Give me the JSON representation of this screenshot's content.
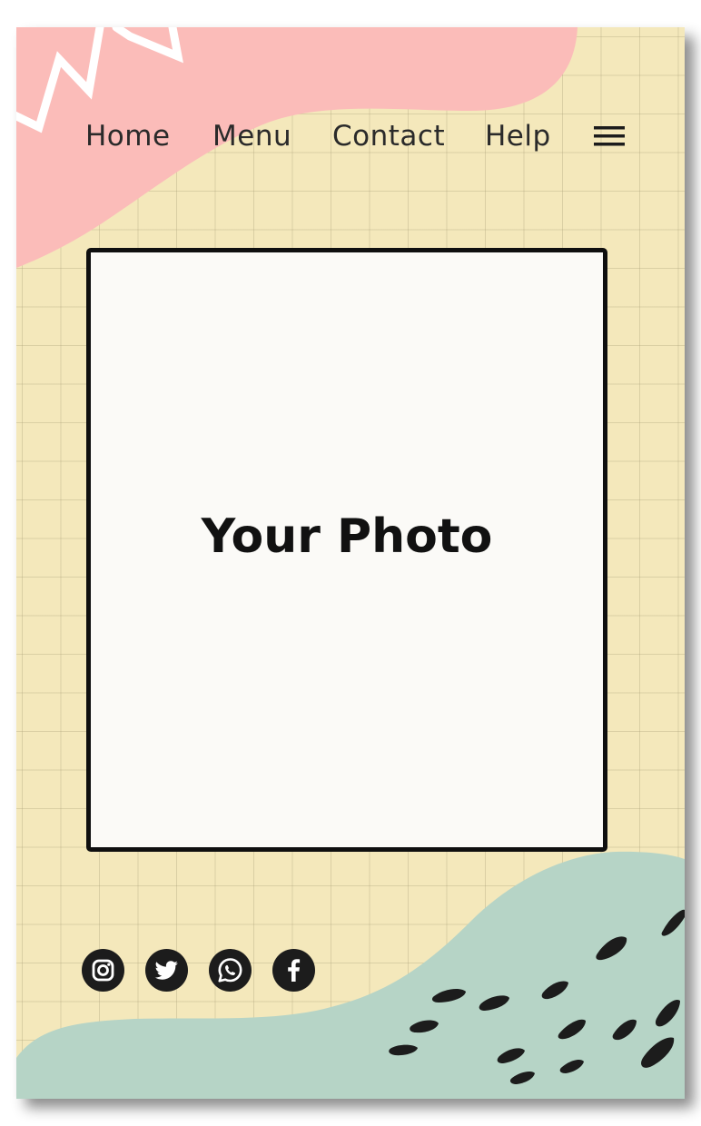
{
  "nav": {
    "items": [
      "Home",
      "Menu",
      "Contact",
      "Help"
    ]
  },
  "menu_icon": "hamburger-menu-icon",
  "photo": {
    "placeholder_text": "Your Photo"
  },
  "social_links": [
    {
      "icon": "instagram-icon"
    },
    {
      "icon": "twitter-icon"
    },
    {
      "icon": "whatsapp-icon"
    },
    {
      "icon": "facebook-icon"
    }
  ],
  "colors": {
    "background": "#f4e8bb",
    "grid_lines": "#d8cc9a",
    "pink_blob": "#fbbcb9",
    "mint_blob": "#b6d4c6",
    "dark": "#1c1c1c",
    "photo_fill": "#fbfaf7"
  }
}
